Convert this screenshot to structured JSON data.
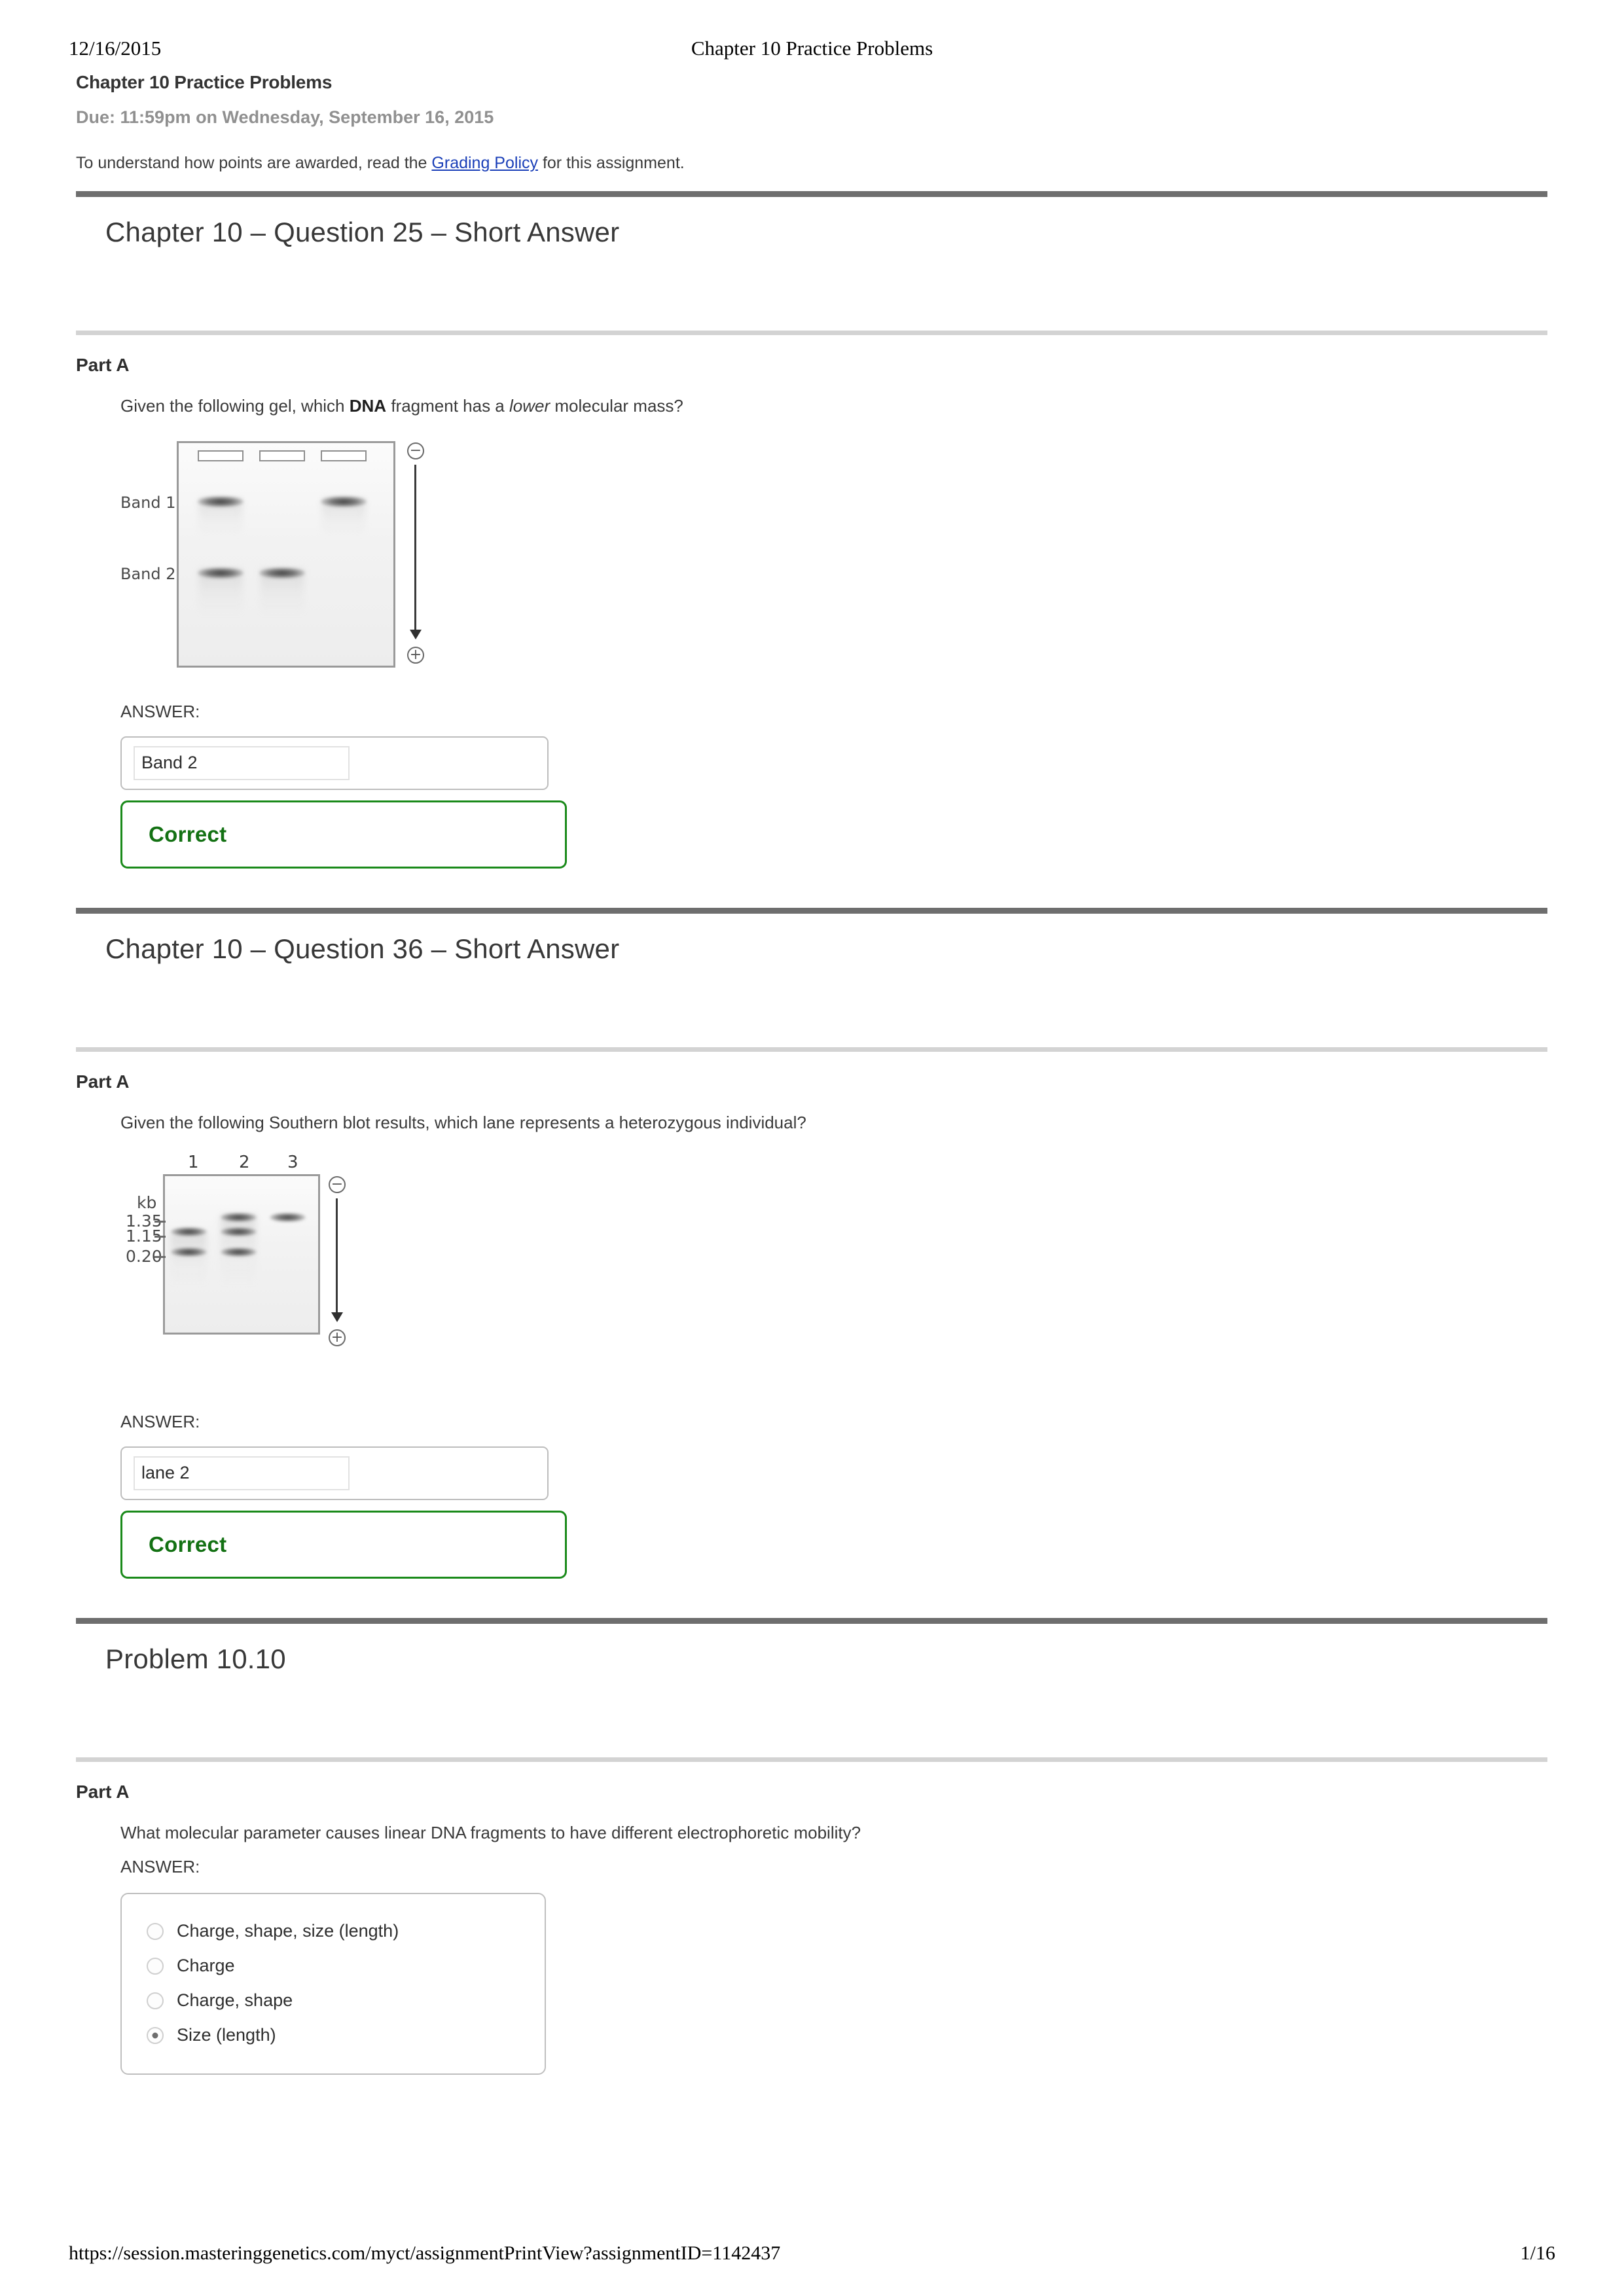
{
  "print": {
    "date": "12/16/2015",
    "doc_title": "Chapter 10 Practice Problems",
    "footer_url": "https://session.masteringgenetics.com/myct/assignmentPrintView?assignmentID=1142437",
    "page_number": "1/16"
  },
  "assignment": {
    "title": "Chapter 10 Practice Problems",
    "due": "Due: 11:59pm on Wednesday, September 16, 2015",
    "policy_prefix": "To understand how points are awarded, read the ",
    "policy_link": "Grading Policy",
    "policy_suffix": " for this assignment."
  },
  "colors": {
    "rule_dark": "#6e6e6e",
    "rule_light": "#d3d3d3",
    "link": "#1a3fb8",
    "correct_green": "#137113",
    "correct_border": "#1a8a1a"
  },
  "questions": [
    {
      "header": "Chapter 10 – Question 25 – Short Answer",
      "part_label": "Part A",
      "prompt_pre": "Given the following gel, which ",
      "prompt_bold": "DNA",
      "prompt_mid": " fragment has a ",
      "prompt_italic": "lower",
      "prompt_post": " molecular mass?",
      "answer_label": "ANSWER:",
      "answer_value": "Band 2",
      "feedback": "Correct",
      "figure": {
        "type": "agarose-gel",
        "row_labels": [
          "Band 1",
          "Band 2"
        ],
        "lanes": 3,
        "wells": 3,
        "bands": [
          {
            "lane": 1,
            "row": "Band 1"
          },
          {
            "lane": 3,
            "row": "Band 1"
          },
          {
            "lane": 1,
            "row": "Band 2"
          },
          {
            "lane": 2,
            "row": "Band 2"
          }
        ],
        "electrode_top": "−",
        "electrode_bottom": "+"
      }
    },
    {
      "header": "Chapter 10 – Question 36 – Short Answer",
      "part_label": "Part A",
      "prompt_pre": "Given the following Southern blot results, which lane represents a heterozygous individual?",
      "answer_label": "ANSWER:",
      "answer_value": "lane 2",
      "feedback": "Correct",
      "figure": {
        "type": "southern-blot",
        "unit_label": "kb",
        "lane_labels": [
          "1",
          "2",
          "3"
        ],
        "size_markers": [
          "1.35",
          "1.15",
          "0.20"
        ],
        "bands": [
          {
            "lane": 1,
            "size": "1.15"
          },
          {
            "lane": 1,
            "size": "0.20"
          },
          {
            "lane": 2,
            "size": "1.35"
          },
          {
            "lane": 2,
            "size": "1.15"
          },
          {
            "lane": 2,
            "size": "0.20"
          },
          {
            "lane": 3,
            "size": "1.35"
          }
        ],
        "electrode_top": "−",
        "electrode_bottom": "+"
      }
    },
    {
      "header": "Problem 10.10",
      "part_label": "Part A",
      "prompt_pre": "What molecular parameter causes linear DNA fragments to have different electrophoretic mobility?",
      "answer_label": "ANSWER:",
      "choices": [
        {
          "label": "Charge, shape, size (length)",
          "selected": false
        },
        {
          "label": "Charge",
          "selected": false
        },
        {
          "label": "Charge, shape",
          "selected": false
        },
        {
          "label": "Size (length)",
          "selected": true
        }
      ]
    }
  ]
}
